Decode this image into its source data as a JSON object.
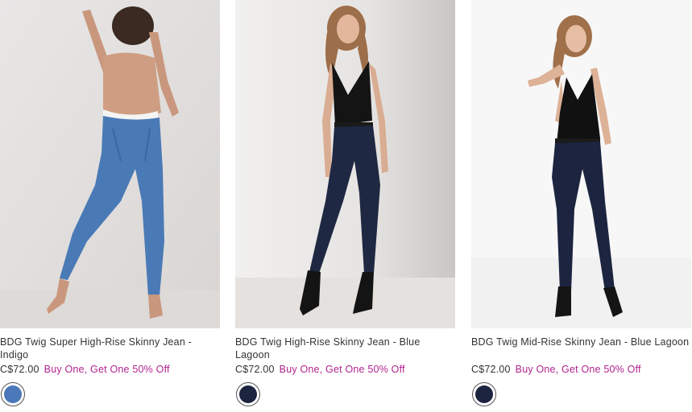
{
  "products": [
    {
      "name": "BDG Twig Super High-Rise Skinny Jean - Indigo",
      "price": "C$72.00",
      "promo": "Buy One, Get One 50% Off",
      "swatch_color": "#4a78b8",
      "image_desc_icon": "model-photo-icon"
    },
    {
      "name": "BDG Twig High-Rise Skinny Jean - Blue Lagoon",
      "price": "C$72.00",
      "promo": "Buy One, Get One 50% Off",
      "swatch_color": "#1c2440",
      "image_desc_icon": "model-photo-icon"
    },
    {
      "name": "BDG Twig Mid-Rise Skinny Jean - Blue Lagoon",
      "price": "C$72.00",
      "promo": "Buy One, Get One 50% Off",
      "swatch_color": "#1c2440",
      "image_desc_icon": "model-photo-icon"
    }
  ],
  "colors": {
    "promo": "#b0238e",
    "text": "#333333"
  }
}
